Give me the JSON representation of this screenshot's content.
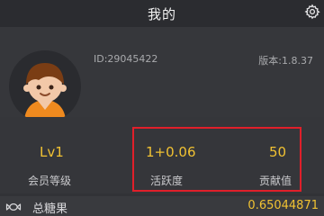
{
  "header": {
    "title": "我的",
    "settings_icon": "gear-icon"
  },
  "profile": {
    "avatar_icon": "boy-avatar-icon",
    "user_id": "ID:29045422",
    "version": "版本:1.8.37"
  },
  "stats": [
    {
      "value": "Lv1",
      "label": "会员等级"
    },
    {
      "value": "1+0.06",
      "label": "活跃度"
    },
    {
      "value": "50",
      "label": "贡献值"
    }
  ],
  "candy": {
    "icon": "candy-icon",
    "label": "总糖果",
    "value": "0.65044871"
  },
  "colors": {
    "background": "#313236",
    "accent": "#f1c232",
    "highlight_border": "#e01f2a",
    "avatar_bg": "#2a2b2f",
    "shirt": "#ef8a1f",
    "hair": "#7a3d14",
    "skin": "#f2c8a8"
  }
}
